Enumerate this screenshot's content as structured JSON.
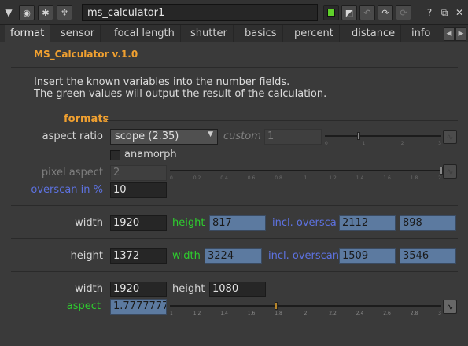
{
  "window": {
    "node_name": "ms_calculator1"
  },
  "icons": {
    "collapse": "triangle-down-icon",
    "settings": "radio-icon",
    "bug": "bug-icon",
    "tool": "wrench-icon",
    "color_swatch": "green-square-icon",
    "edit": "pencil-icon",
    "undo": "undo-icon",
    "redo": "redo-icon",
    "revert": "revert-icon",
    "help": "question-icon",
    "float": "float-window-icon",
    "close": "close-icon"
  },
  "tabs": [
    "format",
    "sensor",
    "focal length",
    "shutter",
    "basics",
    "percent",
    "distance",
    "info"
  ],
  "header": {
    "title": "MS_Calculator v.1.0",
    "desc_line1": "Insert the known variables into the number fields.",
    "desc_line2": "The green values will output the result of the calculation."
  },
  "formats": {
    "section_title": "formats",
    "aspect_ratio_label": "aspect ratio",
    "aspect_ratio_value": "scope  (2.35)",
    "custom_label": "custom",
    "custom_value": "1",
    "custom_slider_fraction": 0.29,
    "custom_slider_ticks": [
      "0",
      "1",
      "2",
      "3"
    ],
    "anamorph_label": "anamorph",
    "anamorph_checked": false,
    "pixel_aspect_label": "pixel aspect",
    "pixel_aspect_value": "2",
    "pixel_aspect_slider_fraction": 1.0,
    "pixel_aspect_ticks": [
      "0",
      "0.2",
      "0.4",
      "0.6",
      "0.8",
      "1",
      "1.2",
      "1.4",
      "1.6",
      "1.8",
      "2"
    ],
    "overscan_label": "overscan in %",
    "overscan_value": "10"
  },
  "row1": {
    "width_label": "width",
    "width_value": "1920",
    "height_label": "height",
    "height_value": "817",
    "incl_label": "incl. overscan",
    "incl_w": "2112",
    "incl_h": "898"
  },
  "row2": {
    "height_label": "height",
    "height_value": "1372",
    "width_label": "width",
    "width_value": "3224",
    "incl_label": "incl. overscan",
    "incl_w": "1509",
    "incl_h": "3546"
  },
  "row3": {
    "width_label": "width",
    "width_value": "1920",
    "height_label": "height",
    "height_value": "1080",
    "aspect_label": "aspect",
    "aspect_value": "1.7777777",
    "aspect_slider_fraction": 0.39,
    "aspect_ticks": [
      "1",
      "1.2",
      "1.4",
      "1.6",
      "1.8",
      "2",
      "2.2",
      "2.4",
      "2.6",
      "2.8",
      "3"
    ]
  }
}
